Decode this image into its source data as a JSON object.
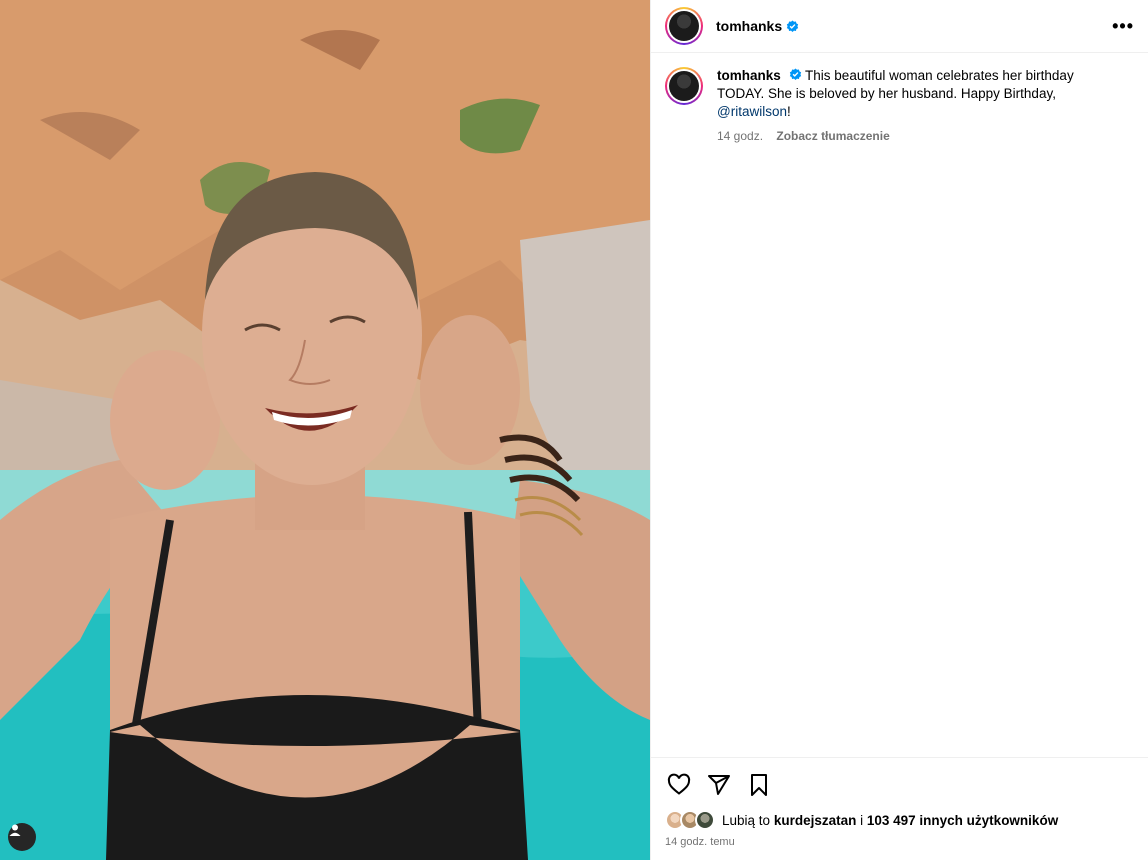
{
  "post": {
    "username": "tomhanks",
    "verified": true,
    "caption_text": "This beautiful woman celebrates her birthday TODAY.  She is beloved by her husband. Happy Birthday, ",
    "mention": "@ritawilson",
    "caption_end": "!",
    "time": "14 godz.",
    "translate_label": "Zobacz tłumaczenie",
    "more_icon": "more-horizontal-icon",
    "more_label": "•••"
  },
  "actions": {
    "like_icon": "heart-icon",
    "share_icon": "paper-plane-icon",
    "save_icon": "bookmark-icon"
  },
  "likes": {
    "prefix": "Lubią to",
    "first_user": "kurdejszatan",
    "connector": "i",
    "others": "103 497 innych użytkowników"
  },
  "timestamp": "14 godz. temu",
  "photo": {
    "description_icon": "user-tag-icon"
  },
  "colors": {
    "mention": "#00376b",
    "verified": "#0095f6",
    "meta": "#737373"
  }
}
